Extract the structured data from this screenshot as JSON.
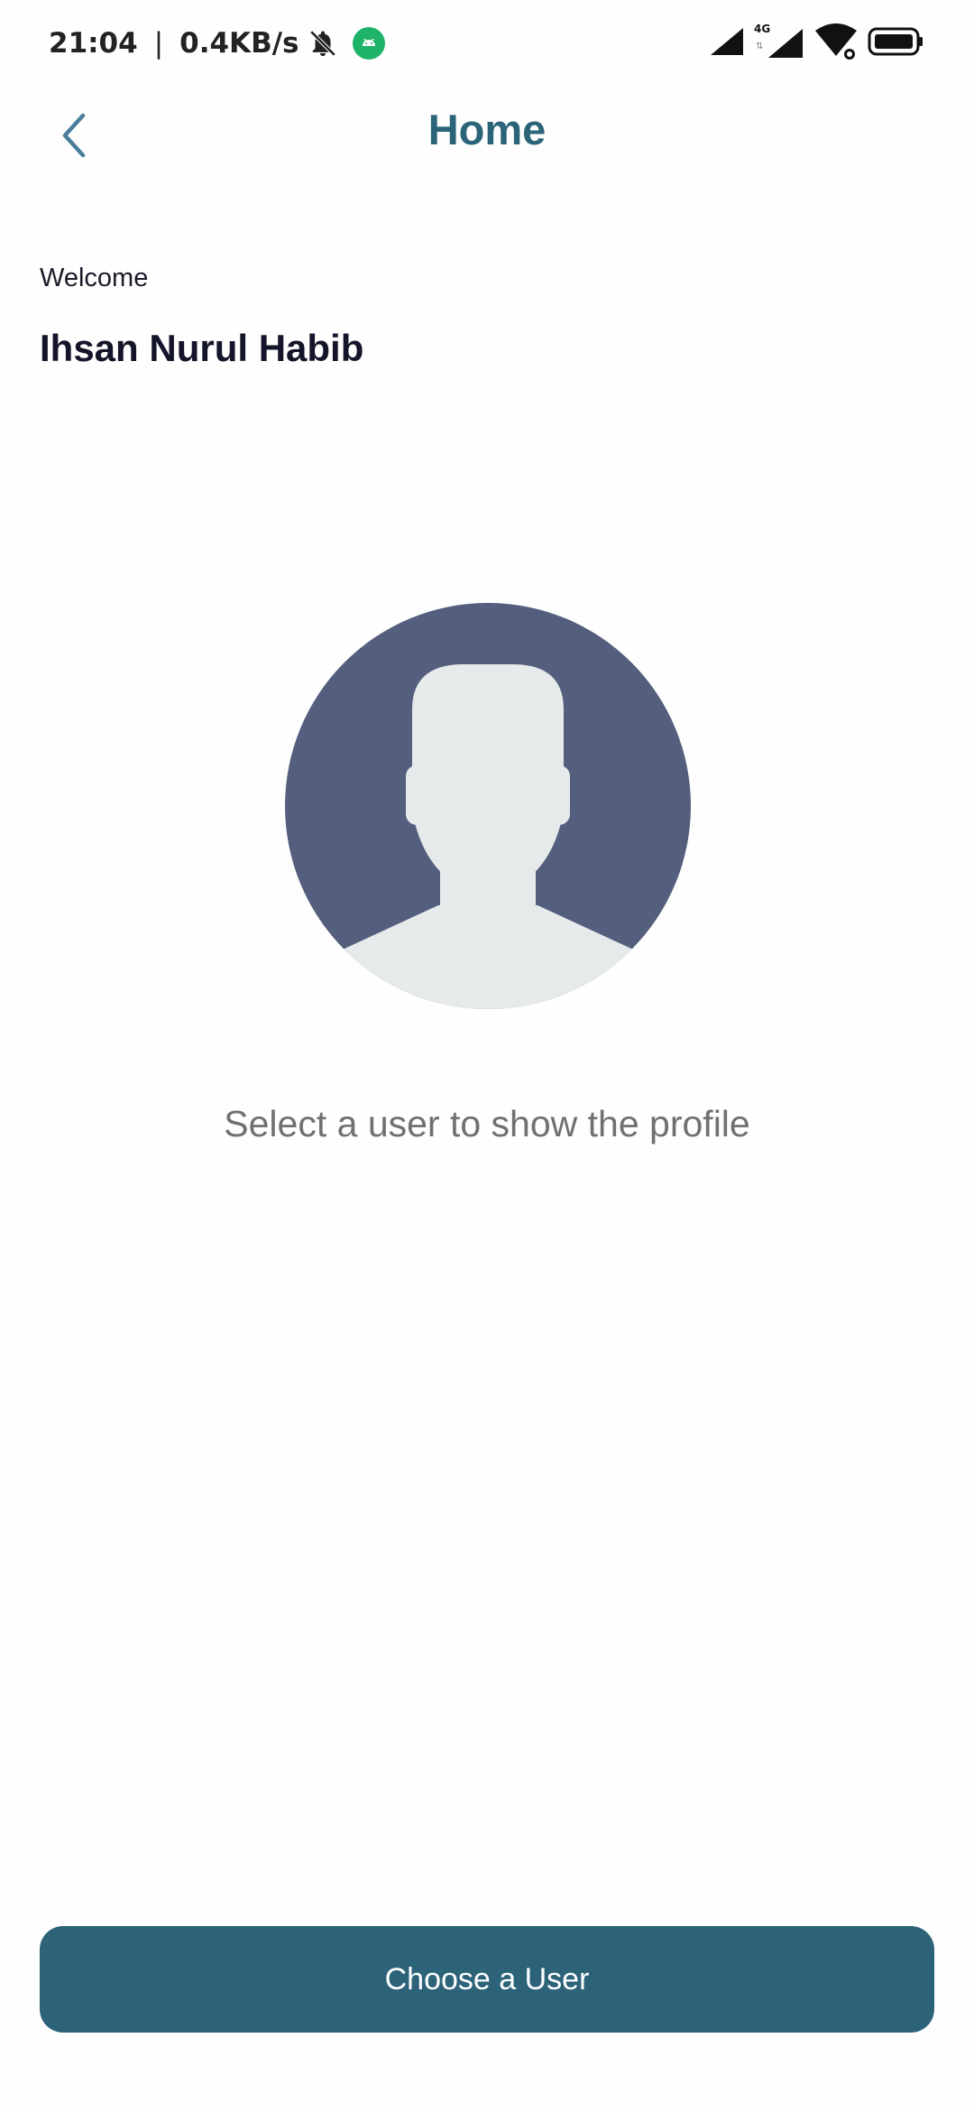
{
  "status_bar": {
    "time": "21:04",
    "separator": "|",
    "net_speed": "0.4KB/s",
    "network_type": "4G"
  },
  "header": {
    "title": "Home",
    "back_icon": "chevron-left-icon"
  },
  "welcome": {
    "label": "Welcome",
    "name": "Ihsan Nurul Habib"
  },
  "main": {
    "avatar_icon": "user-placeholder-icon",
    "hint": "Select a user to show the profile"
  },
  "footer": {
    "choose_button_label": "Choose a User"
  },
  "colors": {
    "primary": "#2c6379",
    "avatar_bg": "#545e7d",
    "avatar_fg": "#e6eaeb",
    "hint_text": "#707070"
  }
}
